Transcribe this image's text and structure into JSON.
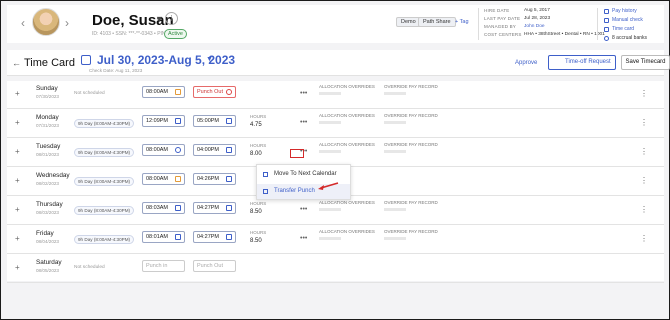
{
  "header": {
    "name": "Doe, Susan",
    "ids": "ID: 4103 • SSN: ***-**-0343 • PIN",
    "status": "Active",
    "tags": [
      "Demo",
      "Path Share"
    ],
    "add_tag": "+ Tag",
    "info": [
      {
        "label": "HIRE DATE",
        "value": "Aug 5, 2017"
      },
      {
        "label": "LAST PAY DATE",
        "value": "Jul 28, 2023"
      },
      {
        "label": "MANAGED BY",
        "value": "John Doe"
      },
      {
        "label": "COST CENTERS",
        "value": "HHA • 38thStreet • Dental • RN • 1001"
      }
    ],
    "links": [
      "Pay history",
      "Manual check",
      "Time card"
    ],
    "accrual": "8 accrual banks"
  },
  "bar": {
    "title": "Time Card",
    "range": "Jul 30, 2023-Aug 5, 2023",
    "check_date": "Check Date: Aug 11, 2023",
    "approve": "Approve",
    "time_off": "Time-off Request",
    "save": "Save Timecard"
  },
  "labels": {
    "hours": "HOURS",
    "allocation": "ALLOCATION OVERRIDES",
    "override_pay": "OVERRIDE PAY RECORD"
  },
  "rows": [
    {
      "day": "Sunday",
      "date": "07/30/2023",
      "sched": "Not scheduled",
      "in": "08:00AM",
      "out": "Punch Out",
      "hours": ""
    },
    {
      "day": "Monday",
      "date": "07/31/2023",
      "sched": "9h Day (8:00AM-4:30PM)",
      "in": "12:09PM",
      "out": "05:00PM",
      "hours": "4.75"
    },
    {
      "day": "Tuesday",
      "date": "08/01/2023",
      "sched": "9h Day (8:00AM-4:30PM)",
      "in": "08:00AM",
      "out": "04:00PM",
      "hours": "8.00"
    },
    {
      "day": "Wednesday",
      "date": "08/02/2023",
      "sched": "9h Day (8:00AM-4:30PM)",
      "in": "08:00AM",
      "out": "04:26PM",
      "hours": ""
    },
    {
      "day": "Thursday",
      "date": "08/03/2023",
      "sched": "9h Day (8:00AM-4:30PM)",
      "in": "08:03AM",
      "out": "04:27PM",
      "hours": "8.50"
    },
    {
      "day": "Friday",
      "date": "08/04/2023",
      "sched": "9h Day (8:00AM-4:30PM)",
      "in": "08:01AM",
      "out": "04:27PM",
      "hours": "8.50"
    },
    {
      "day": "Saturday",
      "date": "08/05/2023",
      "sched": "Not scheduled",
      "in": "Punch in",
      "out": "Punch Out",
      "hours": ""
    }
  ],
  "menu": {
    "items": [
      "Move To Next Calendar",
      "Transfer Punch"
    ]
  },
  "colors": {
    "accent": "#3e5fc9",
    "highlight": "#d42a2a"
  }
}
